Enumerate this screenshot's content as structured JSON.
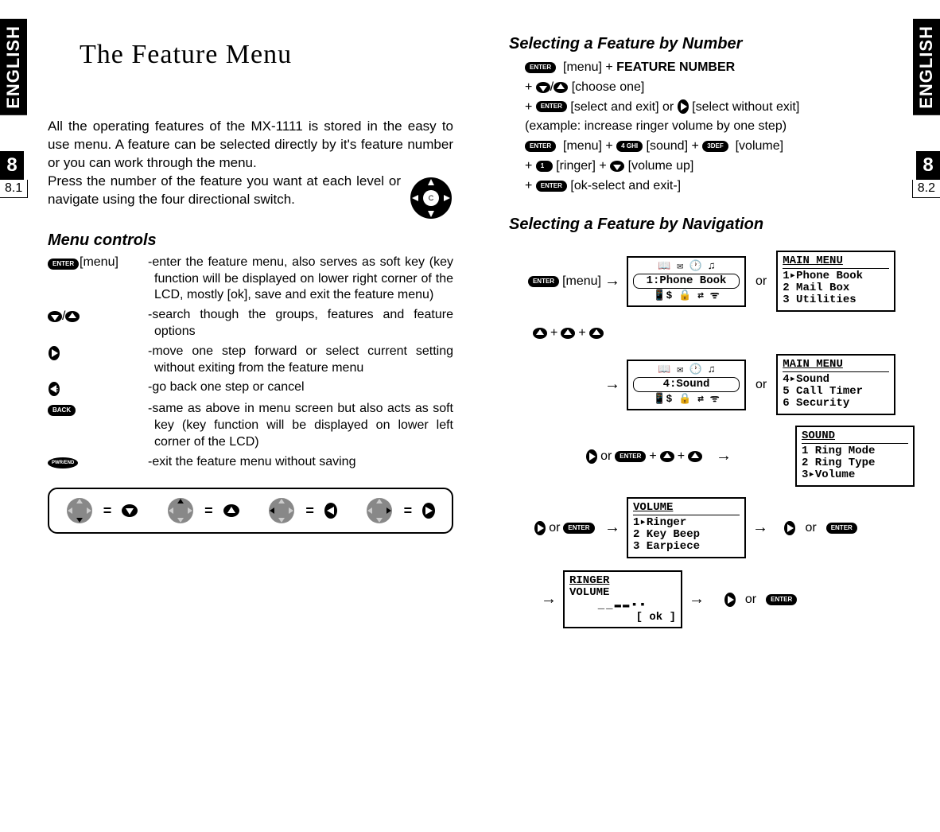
{
  "language_tab": "ENGLISH",
  "chapter": "8",
  "page_left_num": "8.1",
  "page_right_num": "8.2",
  "title": "The Feature Menu",
  "intro1": "All the operating features of the MX-1111 is stored in the easy to use menu. A feature can be selected directly by it's feature number or you can work through the menu.",
  "intro2": "Press the number of the feature you want at each level or navigate using the four directional switch.",
  "menu_controls_heading": "Menu controls",
  "controls": [
    {
      "label": "[menu]",
      "desc": "-enter the feature menu, also serves as soft key (key function will be displayed on lower right corner of the LCD, mostly [ok], save and exit the feature menu)"
    },
    {
      "label": "",
      "desc": "-search though the groups, features and feature options"
    },
    {
      "label": "",
      "desc": "-move one step forward or select current setting without exiting from the feature menu"
    },
    {
      "label": "",
      "desc": "-go back one step or cancel"
    },
    {
      "label": "",
      "desc": "-same as above in menu screen but also acts as soft key (key function will be displayed on lower left corner of the LCD)"
    },
    {
      "label": "",
      "desc": "-exit the feature menu without saving"
    }
  ],
  "legend_eq": "=",
  "sel_number_heading": "Selecting a Feature by Number",
  "sel_lines": {
    "l1a": "[menu] + ",
    "l1b": "FEATURE NUMBER",
    "l2a": "+  ",
    "l2b": "/",
    "l2c": "  [choose one]",
    "l3a": "+  ",
    "l3b": "  [select and exit] or  ",
    "l3c": "  [select without exit]",
    "l4": "(example: increase ringer volume by one step)",
    "l5a": "[menu] + ",
    "l5b": "[sound] + ",
    "l5c": "[volume]",
    "l6a": "+  ",
    "l6b": "  [ringer] +  ",
    "l6c": "  [volume up]",
    "l7a": "+  ",
    "l7b": "  [ok-select and exit-]"
  },
  "sel_nav_heading": "Selecting a Feature by Navigation",
  "flow": {
    "menuLabel": "[menu]",
    "or": "or",
    "plus": "+",
    "lcd_phonebook_title": "1:Phone Book",
    "lcd_main1_hdr": "MAIN MENU",
    "lcd_main1_l1": "1▸Phone Book",
    "lcd_main1_l2": "2  Mail Box",
    "lcd_main1_l3": "3  Utilities",
    "lcd_sound_title": "4:Sound",
    "lcd_main2_hdr": "MAIN MENU",
    "lcd_main2_l1": "4▸Sound",
    "lcd_main2_l2": "5  Call Timer",
    "lcd_main2_l3": "6  Security",
    "lcd_sound_hdr": "SOUND",
    "lcd_sound_l1": "1  Ring Mode",
    "lcd_sound_l2": "2  Ring Type",
    "lcd_sound_l3": "3▸Volume",
    "lcd_vol_hdr": "VOLUME",
    "lcd_vol_l1": "1▸Ringer",
    "lcd_vol_l2": "2  Key Beep",
    "lcd_vol_l3": "3  Earpiece",
    "lcd_ringer_l1": "RINGER",
    "lcd_ringer_l2": "VOLUME",
    "lcd_ringer_l3": "__▬▬▪▪",
    "lcd_ringer_l4": "[ ok ]"
  },
  "icons": {
    "enter": "ENTER",
    "back": "BACK",
    "pwr": "PWR/END"
  }
}
